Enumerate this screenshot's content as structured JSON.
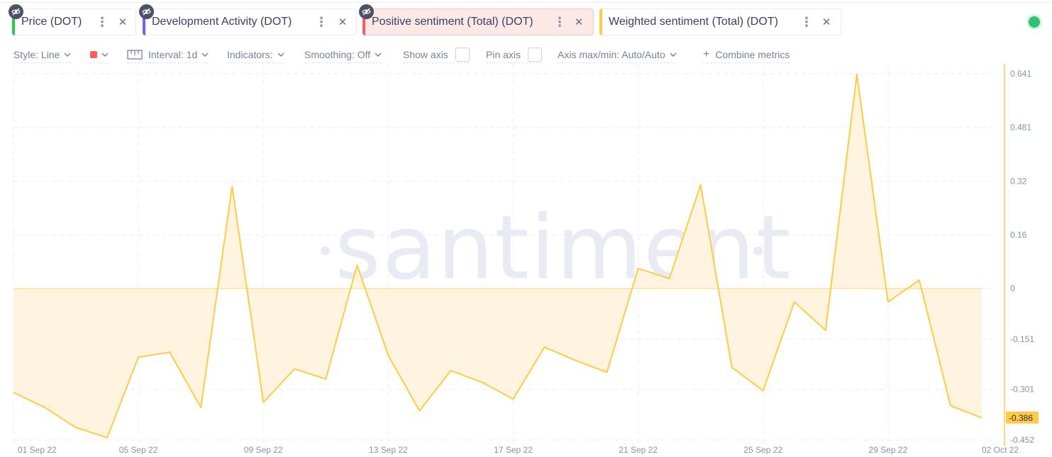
{
  "metrics": [
    {
      "label": "Price (DOT)",
      "color": "#26c953"
    },
    {
      "label": "Development Activity (DOT)",
      "color": "#8358ff"
    },
    {
      "label": "Positive sentiment (Total) (DOT)",
      "color": "#ff5b5b"
    },
    {
      "label": "Weighted sentiment (Total) (DOT)",
      "color": "#ffcb47"
    }
  ],
  "toolbar": {
    "style": "Style: Line",
    "interval": "Interval: 1d",
    "indicators": "Indicators:",
    "smoothing": "Smoothing: Off",
    "show_axis": "Show axis",
    "pin_axis": "Pin axis",
    "axis_maxmin": "Axis max/min: Auto/Auto",
    "combine": "Combine metrics",
    "color_swatch": "#ff5b5b"
  },
  "watermark": "santiment",
  "chart_data": {
    "type": "area",
    "series": [
      {
        "color": "#ffcb47",
        "x": [
          "2022-09-01",
          "2022-09-02",
          "2022-09-03",
          "2022-09-04",
          "2022-09-05",
          "2022-09-06",
          "2022-09-07",
          "2022-09-08",
          "2022-09-09",
          "2022-09-10",
          "2022-09-11",
          "2022-09-12",
          "2022-09-13",
          "2022-09-14",
          "2022-09-15",
          "2022-09-16",
          "2022-09-17",
          "2022-09-18",
          "2022-09-19",
          "2022-09-20",
          "2022-09-21",
          "2022-09-22",
          "2022-09-23",
          "2022-09-24",
          "2022-09-25",
          "2022-09-26",
          "2022-09-27",
          "2022-09-28",
          "2022-09-29",
          "2022-09-30",
          "2022-10-01",
          "2022-10-02"
        ],
        "values": [
          -0.31,
          -0.355,
          -0.415,
          -0.445,
          -0.205,
          -0.19,
          -0.355,
          0.305,
          -0.34,
          -0.24,
          -0.27,
          0.07,
          -0.2,
          -0.365,
          -0.245,
          -0.28,
          -0.33,
          -0.175,
          -0.215,
          -0.25,
          0.06,
          0.03,
          0.31,
          -0.235,
          -0.305,
          -0.04,
          -0.125,
          0.64,
          -0.04,
          0.025,
          -0.35,
          -0.386
        ]
      }
    ],
    "x_ticks": [
      "01 Sep 22",
      "05 Sep 22",
      "09 Sep 22",
      "13 Sep 22",
      "17 Sep 22",
      "21 Sep 22",
      "25 Sep 22",
      "29 Sep 22",
      "02 Oct 22"
    ],
    "y_ticks": [
      "0.641",
      "0.481",
      "0.32",
      "0.16",
      "0",
      "-0.151",
      "-0.301",
      "-0.452"
    ],
    "ylim": [
      -0.452,
      0.641
    ],
    "last_value_label": "-0.386",
    "grid": true,
    "axis_color": "#ffcb47"
  }
}
